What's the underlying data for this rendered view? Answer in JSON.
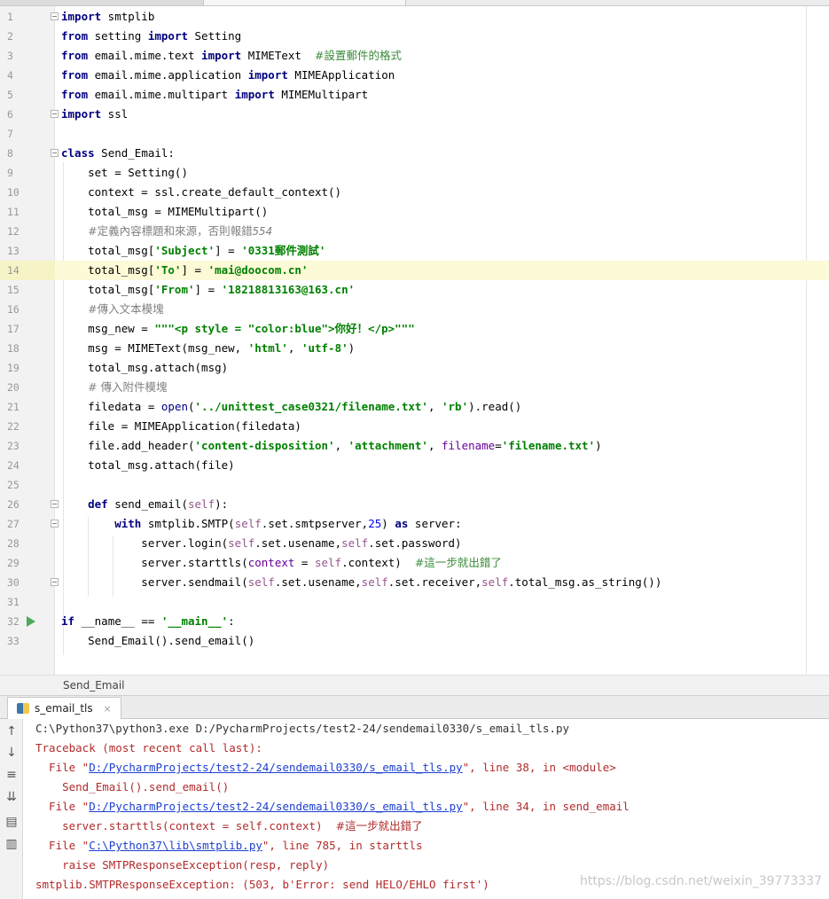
{
  "editor": {
    "current_line": 14,
    "lines": [
      {
        "n": "1"
      },
      {
        "n": "2"
      },
      {
        "n": "3"
      },
      {
        "n": "4"
      },
      {
        "n": "5"
      },
      {
        "n": "6"
      },
      {
        "n": "7"
      },
      {
        "n": "8"
      },
      {
        "n": "9"
      },
      {
        "n": "10"
      },
      {
        "n": "11"
      },
      {
        "n": "12"
      },
      {
        "n": "13"
      },
      {
        "n": "14"
      },
      {
        "n": "15"
      },
      {
        "n": "16"
      },
      {
        "n": "17"
      },
      {
        "n": "18"
      },
      {
        "n": "19"
      },
      {
        "n": "20"
      },
      {
        "n": "21"
      },
      {
        "n": "22"
      },
      {
        "n": "23"
      },
      {
        "n": "24"
      },
      {
        "n": "25"
      },
      {
        "n": "26"
      },
      {
        "n": "27"
      },
      {
        "n": "28"
      },
      {
        "n": "29"
      },
      {
        "n": "30"
      },
      {
        "n": "31"
      },
      {
        "n": "32"
      },
      {
        "n": "33"
      }
    ],
    "t": {
      "import": "import",
      "from": "from",
      "class": "class",
      "def": "def",
      "with": "with",
      "as": "as",
      "if": "if",
      "l1_rest": " smtplib",
      "l2_a": " setting ",
      "l2_b": " Setting",
      "l3_a": " email.mime.text ",
      "l3_b": " MIMEText  ",
      "l3_c": "#設置郵件的格式",
      "l4_a": " email.mime.application ",
      "l4_b": " MIMEApplication",
      "l5_a": " email.mime.multipart ",
      "l5_b": " MIMEMultipart",
      "l6_rest": " ssl",
      "l8_rest": " Send_Email:",
      "l9": "    set = Setting()",
      "l10": "    context = ssl.create_default_context()",
      "l11": "    total_msg = MIMEMultipart()",
      "l12_pre": "    ",
      "l12_c": "#定義內容標題和來源，否則報錯",
      "l12_n": "554",
      "l13_a": "    total_msg[",
      "l13_s1": "'Subject'",
      "l13_b": "] = ",
      "l13_s2": "'0331郵件測試'",
      "l14_a": "    total_msg[",
      "l14_s1": "'To'",
      "l14_b": "] = ",
      "l14_s2": "'mai@doocom.cn'",
      "l15_a": "    total_msg[",
      "l15_s1": "'From'",
      "l15_b": "] = ",
      "l15_s2": "'18218813163@163.cn'",
      "l16_pre": "    ",
      "l16_c": "#傳入文本模塊",
      "l17_a": "    msg_new = ",
      "l17_s": "\"\"\"<p style = \"color:blue\">你好！</p>\"\"\"",
      "l18_a": "    msg = MIMEText(msg_new, ",
      "l18_s1": "'html'",
      "l18_b": ", ",
      "l18_s2": "'utf-8'",
      "l18_c": ")",
      "l19": "    total_msg.attach(msg)",
      "l20_pre": "    ",
      "l20_c": "# 傳入附件模塊",
      "l21_a": "    filedata = ",
      "l21_open": "open",
      "l21_b": "(",
      "l21_s1": "'../unittest_case0321/filename.txt'",
      "l21_c": ", ",
      "l21_s2": "'rb'",
      "l21_d": ").read()",
      "l22": "    file = MIMEApplication(filedata)",
      "l23_a": "    file.add_header(",
      "l23_s1": "'content-disposition'",
      "l23_b": ", ",
      "l23_s2": "'attachment'",
      "l23_c": ", ",
      "l23_p": "filename",
      "l23_d": "=",
      "l23_s3": "'filename.txt'",
      "l23_e": ")",
      "l24": "    total_msg.attach(file)",
      "l26_pre": "    ",
      "l26_a": " send_email(",
      "l26_self": "self",
      "l26_b": "):",
      "l27_pre": "        ",
      "l27_a": " smtplib.SMTP(",
      "l27_self": "self",
      "l27_b": ".set.smtpserver,",
      "l27_n": "25",
      "l27_c": ") ",
      "l27_d": " server:",
      "l28_a": "            server.login(",
      "l28_self1": "self",
      "l28_b": ".set.usename,",
      "l28_self2": "self",
      "l28_c": ".set.password)",
      "l29_a": "            server.starttls(",
      "l29_p": "context",
      "l29_b": " = ",
      "l29_self": "self",
      "l29_c": ".context)  ",
      "l29_cmt": "#這一步就出錯了",
      "l30_a": "            server.sendmail(",
      "l30_self1": "self",
      "l30_b": ".set.usename,",
      "l30_self2": "self",
      "l30_c": ".set.receiver,",
      "l30_self3": "self",
      "l30_d": ".total_msg.as_string())",
      "l32_a": " __name__ == ",
      "l32_s": "'__main__'",
      "l32_b": ":",
      "l33": "    Send_Email().send_email()"
    }
  },
  "breadcrumb": {
    "text": "Send_Email"
  },
  "run_panel": {
    "tab_label": "s_email_tls",
    "close_glyph": "×",
    "console": {
      "l1": "C:\\Python37\\python3.exe D:/PycharmProjects/test2-24/sendemail0330/s_email_tls.py",
      "l2": "Traceback (most recent call last):",
      "l3_a": "  File \"",
      "l3_link": "D:/PycharmProjects/test2-24/sendemail0330/s_email_tls.py",
      "l3_b": "\", line 38, in <module>",
      "l4": "    Send_Email().send_email()",
      "l5_a": "  File \"",
      "l5_link": "D:/PycharmProjects/test2-24/sendemail0330/s_email_tls.py",
      "l5_b": "\", line 34, in send_email",
      "l6_a": "    server.starttls(context = self.context)  ",
      "l6_c": "#這一步就出錯了",
      "l7_a": "  File \"",
      "l7_link": "C:\\Python37\\lib\\smtplib.py",
      "l7_b": "\", line 785, in starttls",
      "l8": "    raise SMTPResponseException(resp, reply)",
      "l9": "smtplib.SMTPResponseException: (503, b'Error: send HELO/EHLO first')"
    }
  },
  "watermark": "https://blog.csdn.net/weixin_39773337"
}
